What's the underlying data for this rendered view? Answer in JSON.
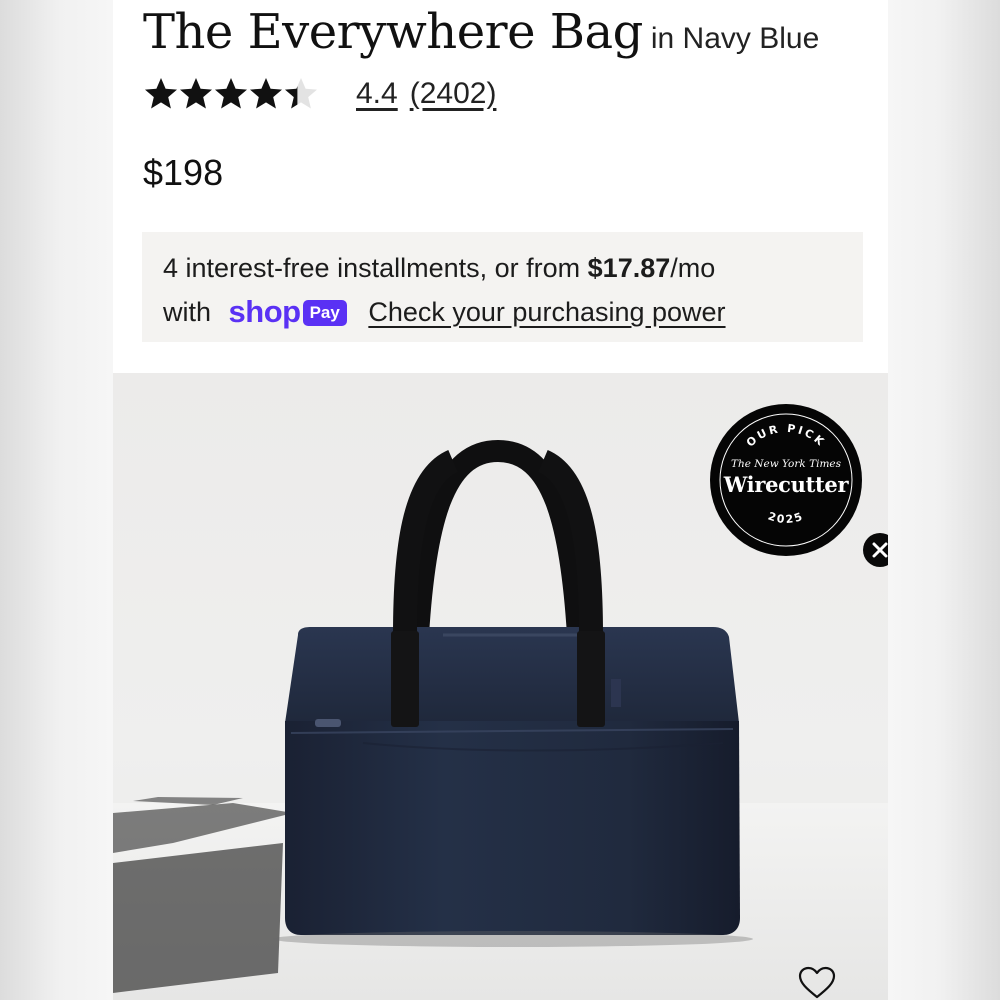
{
  "product": {
    "title": "The Everywhere Bag",
    "color_suffix": "in Navy Blue",
    "rating": {
      "stars_filled": 4.4,
      "stars_total": 5,
      "score": "4.4",
      "count": "(2402)"
    },
    "price": "$198"
  },
  "installments": {
    "line1_prefix": "4 interest-free installments, or from ",
    "amount": "$17.87",
    "line1_suffix": "/mo",
    "with": "with",
    "shop_wordmark": "shop",
    "pay_pill": "Pay",
    "power_link": "Check your purchasing power"
  },
  "badge": {
    "top_arc": "OUR PICK",
    "publisher": "The New York Times",
    "brand": "Wirecutter",
    "year": "2025"
  },
  "icons": {
    "star": "star-icon",
    "close": "close-icon",
    "wishlist": "heart-icon"
  },
  "colors": {
    "shop_purple": "#5a31f4",
    "bag_navy": "#1d2538",
    "badge_black": "#050505",
    "installments_bg": "#f4f3f1"
  }
}
